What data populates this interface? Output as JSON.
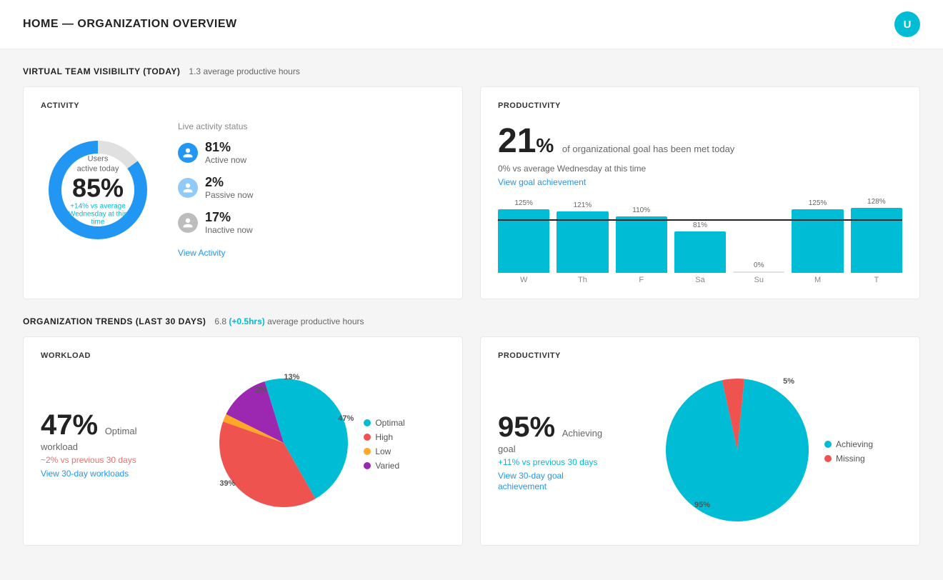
{
  "header": {
    "title": "HOME — ORGANIZATION OVERVIEW",
    "user_initial": "U"
  },
  "team_visibility": {
    "section_title": "VIRTUAL TEAM VISIBILITY (TODAY)",
    "subtitle": "1.3 average productive hours"
  },
  "activity_card": {
    "title": "ACTIVITY",
    "donut": {
      "center_label": "Users active today",
      "percentage": "85%",
      "change": "+14% vs average Wednesday at this time"
    },
    "live_status_title": "Live activity status",
    "statuses": [
      {
        "label": "Active now",
        "pct": "81%",
        "type": "active"
      },
      {
        "label": "Passive now",
        "pct": "2%",
        "type": "passive"
      },
      {
        "label": "Inactive now",
        "pct": "17%",
        "type": "inactive"
      }
    ],
    "view_link": "View Activity"
  },
  "productivity_top": {
    "title": "PRODUCTIVITY",
    "big_pct": "21",
    "goal_text": "of organizational goal has been met today",
    "avg_text": "0% vs average Wednesday at this time",
    "view_link": "View goal achievement",
    "bars": [
      {
        "day": "W",
        "pct": 125,
        "label": "125%"
      },
      {
        "day": "Th",
        "pct": 121,
        "label": "121%"
      },
      {
        "day": "F",
        "pct": 110,
        "label": "110%"
      },
      {
        "day": "Sa",
        "pct": 81,
        "label": "81%"
      },
      {
        "day": "Su",
        "pct": 0,
        "label": "0%",
        "today": true
      },
      {
        "day": "M",
        "pct": 125,
        "label": "125%"
      },
      {
        "day": "T",
        "pct": 128,
        "label": "128%"
      }
    ],
    "goal_line_pct": 100
  },
  "org_trends": {
    "section_title": "ORGANIZATION TRENDS (LAST 30 DAYS)",
    "avg_hrs": "6.8",
    "change": "(+0.5hrs)",
    "change_suffix": "average productive hours"
  },
  "workload_card": {
    "title": "WORKLOAD",
    "big_pct": "47%",
    "label": "Optimal workload",
    "change": "~2% vs previous 30 days",
    "view_link": "View 30-day workloads",
    "pie_segments": [
      {
        "label": "Optimal",
        "pct": 47,
        "color": "#00bcd4",
        "pie_label": "47%"
      },
      {
        "label": "High",
        "pct": 39,
        "color": "#ef5350",
        "pie_label": "39%"
      },
      {
        "label": "Low",
        "pct": 2,
        "color": "#ffa726",
        "pie_label": "2%"
      },
      {
        "label": "Varied",
        "pct": 13,
        "color": "#9c27b0",
        "pie_label": "13%"
      }
    ]
  },
  "productivity_bottom": {
    "title": "PRODUCTIVITY",
    "big_pct": "95%",
    "label": "Achieving goal",
    "change": "+11% vs previous 30 days",
    "view_link": "View 30-day goal achievement",
    "pie_segments": [
      {
        "label": "Achieving",
        "pct": 95,
        "color": "#00bcd4",
        "pie_label": "95%"
      },
      {
        "label": "Missing",
        "pct": 5,
        "color": "#ef5350",
        "pie_label": "5%"
      }
    ]
  }
}
